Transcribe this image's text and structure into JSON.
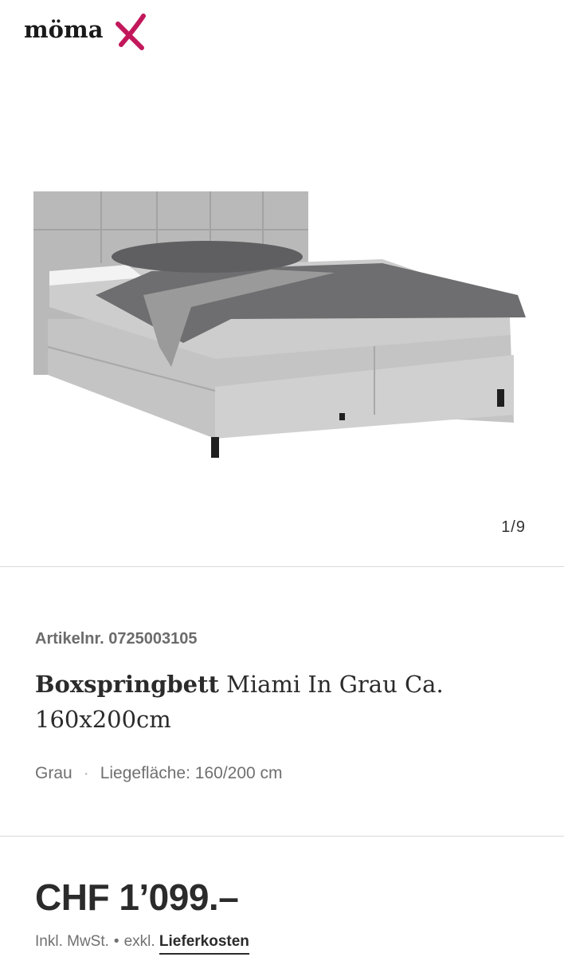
{
  "header": {
    "logo_text": "möma",
    "logo_accent_color": "#c2185b"
  },
  "gallery": {
    "image_alt": "Boxspringbett Miami",
    "counter": "1/9"
  },
  "product": {
    "article_number": "Artikelnr. 0725003105",
    "title_brand": "Boxspringbett",
    "title_rest": " Miami In Grau Ca. 160x200cm",
    "color": "Grau",
    "separator": "·",
    "surface": "Liegefläche: 160/200 cm"
  },
  "pricing": {
    "price": "CHF 1’099.–",
    "tax_note": "Inkl. MwSt.",
    "dot": "•",
    "shipping_prefix": "exkl.",
    "shipping_link": "Lieferkosten"
  }
}
